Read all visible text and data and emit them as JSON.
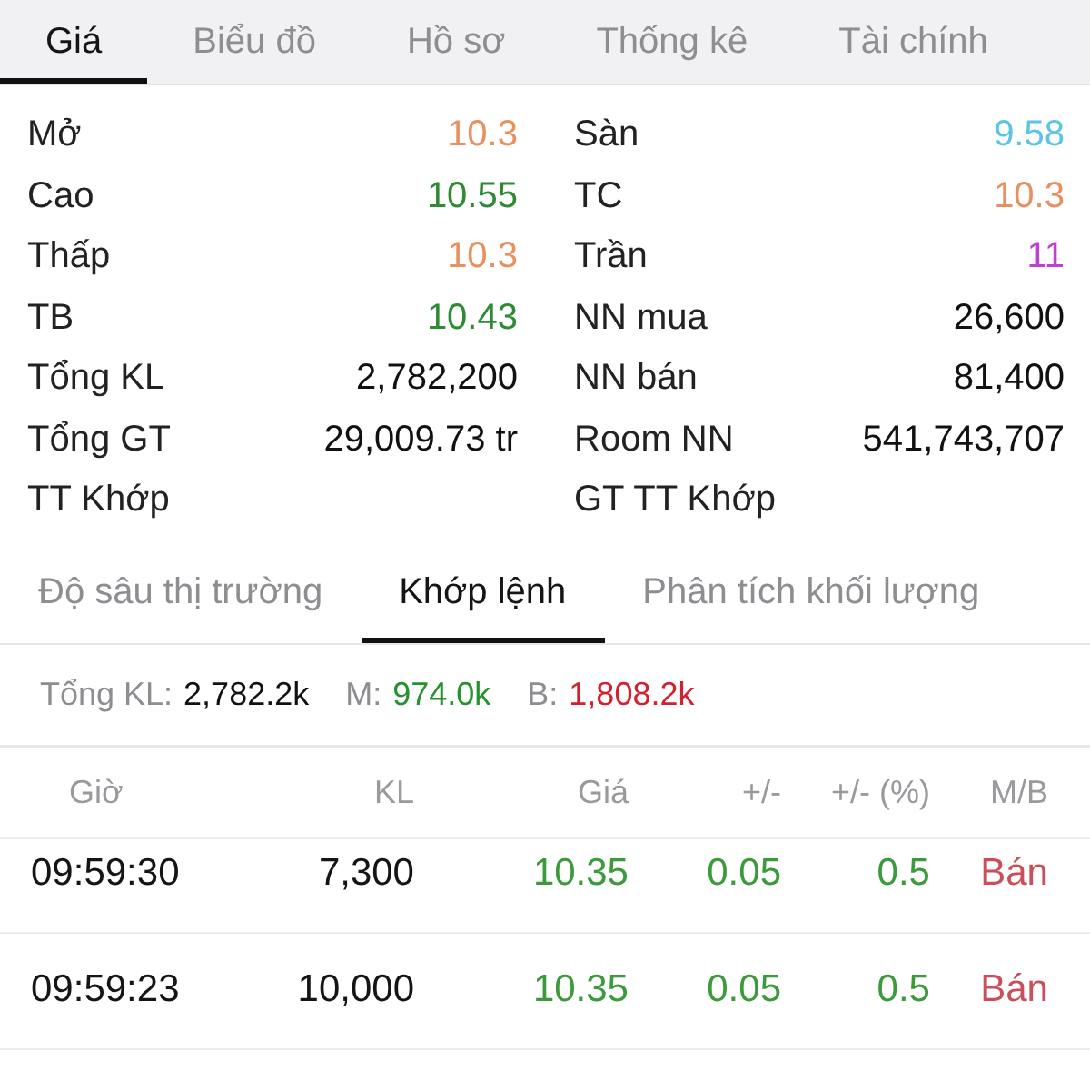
{
  "tabs": [
    {
      "label": "Giá",
      "selected": true
    },
    {
      "label": "Biểu đồ",
      "selected": false
    },
    {
      "label": "Hồ sơ",
      "selected": false
    },
    {
      "label": "Thống kê",
      "selected": false
    },
    {
      "label": "Tài chính",
      "selected": false
    }
  ],
  "stats": {
    "left": [
      {
        "label": "Mở",
        "value": "10.3",
        "color": "#e8905e"
      },
      {
        "label": "Cao",
        "value": "10.55",
        "color": "#2e8b34"
      },
      {
        "label": "Thấp",
        "value": "10.3",
        "color": "#e8905e"
      },
      {
        "label": "TB",
        "value": "10.43",
        "color": "#2e8b34"
      },
      {
        "label": "Tổng KL",
        "value": "2,782,200"
      },
      {
        "label": "Tổng GT",
        "value": "29,009.73 tr"
      },
      {
        "label": "TT Khớp"
      }
    ],
    "right": [
      {
        "label": "Sàn",
        "value": "9.58",
        "color": "#5cc4e6"
      },
      {
        "label": "TC",
        "value": "10.3",
        "color": "#e8905e"
      },
      {
        "label": "Trần",
        "value": "11",
        "color": "#c23fd3"
      },
      {
        "label": "NN mua",
        "value": "26,600"
      },
      {
        "label": "NN bán",
        "value": "81,400"
      },
      {
        "label": "Room NN",
        "value": "541,743,707"
      },
      {
        "label": "GT TT Khớp"
      }
    ]
  },
  "sub_tabs": [
    {
      "label": "Độ sâu thị trường",
      "selected": false
    },
    {
      "label": "Khớp lệnh",
      "selected": true
    },
    {
      "label": "Phân tích khối lượng",
      "selected": false
    }
  ],
  "summary": [
    {
      "label": "Tổng KL:",
      "value": "2,782.2k",
      "color": "#111111"
    },
    {
      "label": "M:",
      "value": "974.0k",
      "color": "#26922e"
    },
    {
      "label": "B:",
      "value": "1,808.2k",
      "color": "#d3202e"
    }
  ],
  "trades": {
    "columns": [
      "Giờ",
      "KL",
      "Giá",
      "+/-",
      "+/- (%)",
      "M/B"
    ],
    "rows": [
      {
        "time": "09:59:30",
        "volume": "7,300",
        "price": "10.35",
        "change": "0.05",
        "change_pct": "0.5",
        "color": "#3b9a3b",
        "side": {
          "text": "Bán",
          "color": "#c9505a"
        }
      },
      {
        "time": "09:59:23",
        "volume": "10,000",
        "price": "10.35",
        "change": "0.05",
        "change_pct": "0.5",
        "color": "#3b9a3b",
        "side": {
          "text": "Bán",
          "color": "#c9505a"
        }
      }
    ]
  }
}
